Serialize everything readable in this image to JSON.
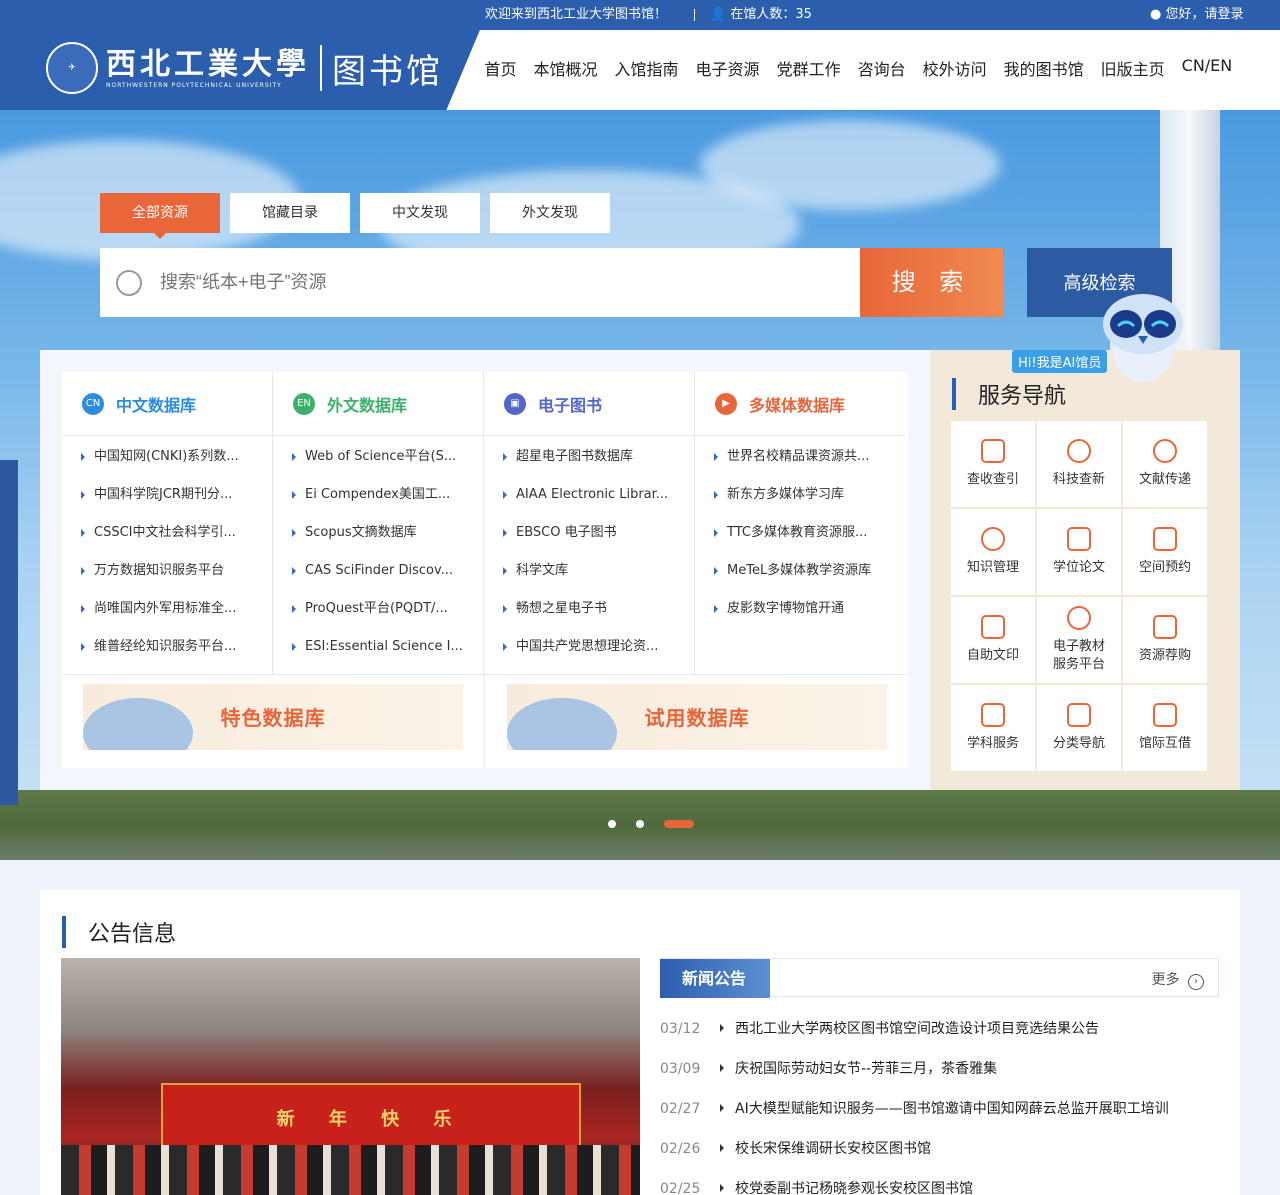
{
  "topbar": {
    "welcome": "欢迎来到西北工业大学图书馆！",
    "online": "在馆人数：35",
    "login": "您好，请登录"
  },
  "logo": {
    "name_cn": "西北工業大學",
    "name_en": "NORTHWESTERN POLYTECHNICAL UNIVERSITY",
    "library": "图书馆"
  },
  "nav": [
    "首页",
    "本馆概况",
    "入馆指南",
    "电子资源",
    "党群工作",
    "咨询台",
    "校外访问",
    "我的图书馆",
    "旧版主页",
    "CN/EN"
  ],
  "search": {
    "tabs": [
      "全部资源",
      "馆藏目录",
      "中文发现",
      "外文发现"
    ],
    "placeholder": "搜索“纸本+电子”资源",
    "button": "搜 索",
    "advanced": "高级检索"
  },
  "databases": [
    {
      "title": "中文数据库",
      "icon_text": "CN",
      "icon": "cn-icon",
      "color": "#2c8ce0",
      "items": [
        "中国知网(CNKI)系列数...",
        "中国科学院JCR期刊分...",
        "CSSCI中文社会科学引...",
        "万方数据知识服务平台",
        "尚唯国内外军用标准全...",
        "维普经纶知识服务平台..."
      ]
    },
    {
      "title": "外文数据库",
      "icon_text": "EN",
      "icon": "en-icon",
      "color": "#3bb26b",
      "items": [
        "Web of Science平台(S...",
        "Ei Compendex美国工...",
        "Scopus文摘数据库",
        "CAS SciFinder Discov...",
        "ProQuest平台(PQDT/...",
        "ESI:Essential Science I..."
      ]
    },
    {
      "title": "电子图书",
      "icon_text": "",
      "icon": "ebook-icon",
      "color": "#5267c9",
      "items": [
        "超星电子图书数据库",
        "AIAA Electronic Librar...",
        "EBSCO 电子图书",
        "科学文库",
        "畅想之星电子书",
        "中国共产党思想理论资..."
      ]
    },
    {
      "title": "多媒体数据库",
      "icon_text": "",
      "icon": "media-icon",
      "color": "#e8663a",
      "items": [
        "世界名校精品课资源共...",
        "新东方多媒体学习库",
        "TTC多媒体教育资源服...",
        "MeTeL多媒体教学资源库",
        "皮影数字博物馆开通"
      ]
    }
  ],
  "featured": [
    "特色数据库",
    "试用数据库"
  ],
  "ai": {
    "tag": "Hi!我是AI馆员"
  },
  "services": {
    "title": "服务导航",
    "items": [
      "查收查引",
      "科技查新",
      "文献传递",
      "知识管理",
      "学位论文",
      "空间预约",
      "自助文印",
      "电子教材服务平台",
      "资源荐购",
      "学科服务",
      "分类导航",
      "馆际互借"
    ]
  },
  "notice": {
    "title": "公告信息",
    "photo_banner": "新 年 快 乐",
    "news_label": "新闻公告",
    "more": "更多",
    "items": [
      {
        "date": "03/12",
        "text": "西北工业大学两校区图书馆空间改造设计项目竞选结果公告"
      },
      {
        "date": "03/09",
        "text": "庆祝国际劳动妇女节--芳菲三月，茶香雅集"
      },
      {
        "date": "02/27",
        "text": "AI大模型赋能知识服务——图书馆邀请中国知网薛云总监开展职工培训"
      },
      {
        "date": "02/26",
        "text": "校长宋保维调研长安校区图书馆"
      },
      {
        "date": "02/25",
        "text": "校党委副书记杨晓参观长安校区图书馆"
      }
    ]
  },
  "colors": {
    "primary": "#2c5eae",
    "accent": "#e8663a"
  }
}
